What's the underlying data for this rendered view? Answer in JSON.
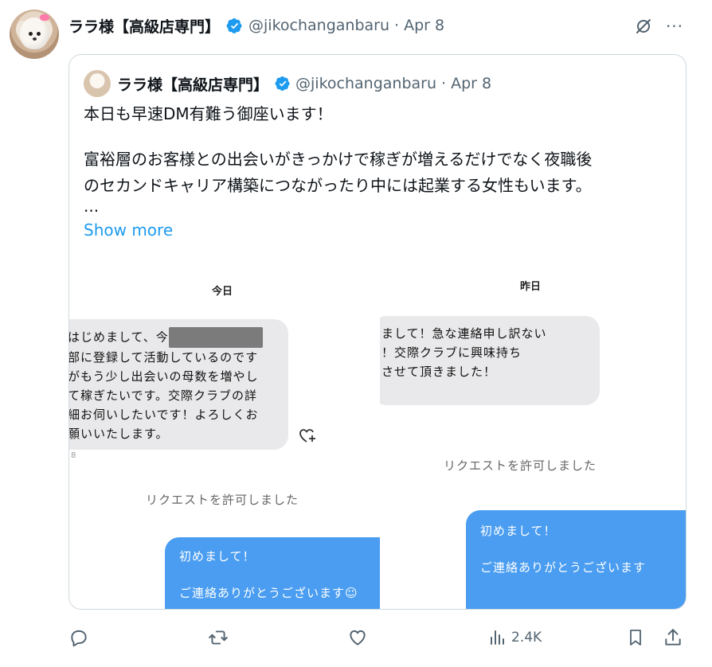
{
  "author": {
    "name": "ララ様【高級店専門】",
    "handle": "@jikochanganbaru",
    "date": "Apr 8",
    "verified": true,
    "avatar": "toy-poodle-avatar"
  },
  "header_icons": {
    "grok": "grok-slash-icon",
    "more": "···"
  },
  "quote": {
    "name": "ララ様【高級店専門】",
    "handle": "@jikochanganbaru",
    "date": "Apr 8",
    "text": {
      "line1": "本日も早速DM有難う御座います！",
      "line2": "富裕層のお客様との出会いがきっかけで稼ぎが増えるだけでなく夜職後",
      "line3": "のセカンドキャリア構築につながったり中には起業する女性もいます。",
      "ellipsis": "..."
    },
    "show_more": "Show more",
    "screenshot_left": {
      "day": "今日",
      "incoming": {
        "line1": "はじめまして、今",
        "line2": "部に登録して活動しているのです",
        "line3": "がもう少し出会いの母数を増やし",
        "line4": "て稼ぎたいです。交際クラブの詳",
        "line5": "細お伺いしたいです！よろしくお",
        "line6": "願いいたします。"
      },
      "tiny": "8",
      "system": "リクエストを許可しました",
      "outgoing": {
        "line1": "初めまして！",
        "line2": "ご連絡ありがとうございます☺"
      }
    },
    "screenshot_right": {
      "day": "昨日",
      "incoming": {
        "line1": "まして！急な連絡申し訳ない",
        "line2": "！交際クラブに興味持ち",
        "line3": "させて頂きました！"
      },
      "system": "リクエストを許可しました",
      "outgoing": {
        "line1": "初めまして！",
        "line2": "ご連絡ありがとうございます"
      }
    }
  },
  "actions": {
    "views": "2.4K"
  },
  "colors": {
    "accent": "#1d9bf0",
    "secondary_text": "#536471",
    "dm_outgoing": "#4a9df0",
    "dm_incoming": "#e9e9eb"
  }
}
